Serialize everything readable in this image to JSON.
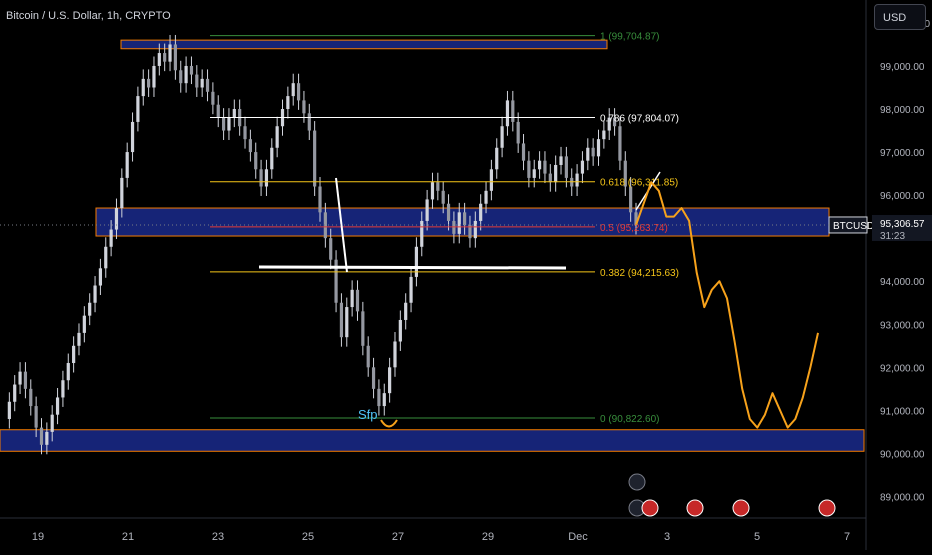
{
  "header": {
    "title": "Bitcoin / U.S. Dollar, 1h, CRYPTO",
    "currency_button": "USD"
  },
  "colors": {
    "background": "#000000",
    "candle": "#d1d4dc",
    "zone_fill": "#1a2a8c",
    "zone_border": "#f57c00",
    "projection": "#f7a21b",
    "fib_top": "#388e3c",
    "fib_786": "#ffffff",
    "fib_618": "#f5c518",
    "fib_05": "#e53935",
    "fib_382": "#f5c518",
    "fib_0": "#388e3c",
    "sfp": "#4fc3f7",
    "axis_text": "#b2b5be"
  },
  "chart_data": {
    "type": "line",
    "title": "Bitcoin / U.S. Dollar, 1h, CRYPTO",
    "xlabel": "",
    "ylabel": "",
    "symbol": "BTCUSD",
    "last_price": "95,306.57",
    "countdown": "31:23",
    "ylim": [
      88500,
      100300
    ],
    "x_ticks": [
      "19",
      "21",
      "23",
      "25",
      "27",
      "29",
      "Dec",
      "3",
      "5",
      "7"
    ],
    "y_ticks": [
      "100,000.00",
      "99,000.00",
      "98,000.00",
      "97,000.00",
      "96,000.00",
      "94,000.00",
      "93,000.00",
      "92,000.00",
      "91,000.00",
      "90,000.00",
      "89,000.00"
    ],
    "y_tick_values": [
      100000,
      99000,
      98000,
      97000,
      96000,
      94000,
      93000,
      92000,
      91000,
      90000,
      89000
    ],
    "fib_levels": [
      {
        "label": "1 (99,704.87)",
        "price": 99704.87,
        "key": "fib_top"
      },
      {
        "label": "0.786 (97,804.07)",
        "price": 97804.07,
        "key": "fib_786"
      },
      {
        "label": "0.618 (96,311.85)",
        "price": 96311.85,
        "key": "fib_618"
      },
      {
        "label": "0.5 (95,263.74)",
        "price": 95263.74,
        "key": "fib_05"
      },
      {
        "label": "0.382 (94,215.63)",
        "price": 94215.63,
        "key": "fib_382"
      },
      {
        "label": "0 (90,822.60)",
        "price": 90822.6,
        "key": "fib_0"
      }
    ],
    "zones": [
      {
        "name": "upper-zone",
        "low": 99400,
        "high": 99600
      },
      {
        "name": "middle-zone",
        "low": 95050,
        "high": 95700
      },
      {
        "name": "lower-zone",
        "low": 90050,
        "high": 90550
      }
    ],
    "annotation": "Sfp",
    "series": [
      {
        "values": [
          90800,
          91200,
          91600,
          91900,
          91500,
          91100,
          90600,
          90200,
          90500,
          90900,
          91300,
          91700,
          92100,
          92500,
          92800,
          93200,
          93500,
          93900,
          94300,
          94800,
          95200,
          95700,
          96400,
          97000,
          97700,
          98300,
          98700,
          98500,
          99000,
          99300,
          99100,
          99500,
          98900,
          98600,
          99000,
          98800,
          98500,
          98700,
          98400,
          98100,
          97800,
          97500,
          97800,
          98000,
          97600,
          97300,
          97000,
          96600,
          96200,
          96600,
          97100,
          97600,
          98000,
          98300,
          98600,
          98200,
          97900,
          97500,
          96200,
          95600,
          95000,
          94500,
          93500,
          92700,
          93400,
          93800,
          93300,
          92500,
          92000,
          91500,
          91100,
          91400,
          92000,
          92600,
          93100,
          93500,
          94100,
          94800,
          95400,
          95900,
          96300,
          96100,
          95800,
          95400,
          95100,
          95600,
          95300,
          95000,
          95400,
          95800,
          96100,
          96600,
          97100,
          97600,
          98200,
          97700,
          97200,
          96800,
          96400,
          96600,
          96800,
          96500,
          96300,
          96700,
          96900,
          96400,
          96200,
          96500,
          96800,
          97100,
          96900,
          97300,
          97500,
          97800,
          97600,
          96800,
          96200,
          95600,
          95306.57
        ]
      },
      {
        "name": "projection",
        "values": [
          95306.57,
          95800,
          96300,
          96100,
          95500,
          95500,
          95700,
          95400,
          94200,
          93400,
          93800,
          94000,
          93600,
          92600,
          91500,
          90800,
          90600,
          90900,
          91400,
          91000,
          90600,
          90800,
          91300,
          92000,
          92800
        ]
      }
    ]
  }
}
